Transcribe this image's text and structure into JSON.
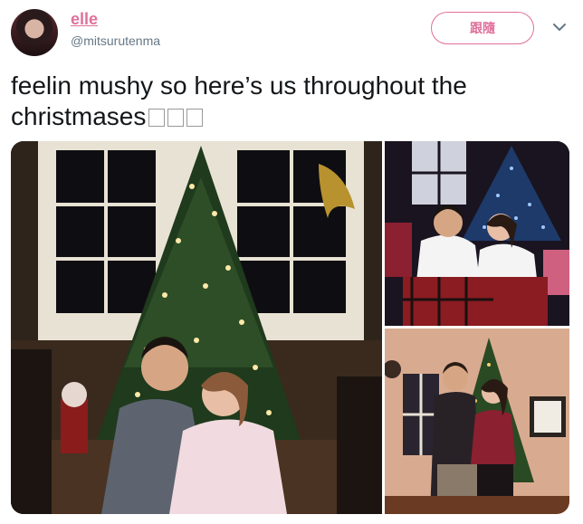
{
  "user": {
    "display_name": "elle",
    "handle": "@mitsurutenma"
  },
  "follow_button": {
    "label": "跟隨"
  },
  "tweet": {
    "text": "feelin mushy so here’s us throughout the christmases"
  },
  "photos": [
    {
      "alt": "couple sitting in front of a lit christmas tree",
      "icon": "photo"
    },
    {
      "alt": "couple in groom and bride shirts by christmas tree",
      "icon": "photo"
    },
    {
      "alt": "couple standing next to christmas tree",
      "icon": "photo"
    }
  ],
  "colors": {
    "accent": "#e0709a",
    "text": "#14171a",
    "secondary": "#657786"
  }
}
